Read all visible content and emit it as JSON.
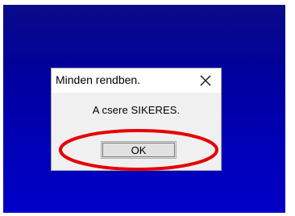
{
  "dialog": {
    "title": "Minden rendben.",
    "message": "A csere SIKERES.",
    "ok_label": "OK",
    "close_icon": "close-icon"
  },
  "annotation": {
    "shape": "ellipse",
    "color": "#e60000",
    "target": "ok-button"
  },
  "colors": {
    "desktop_background": "#0000b0",
    "dialog_background": "#f0f0f0"
  }
}
